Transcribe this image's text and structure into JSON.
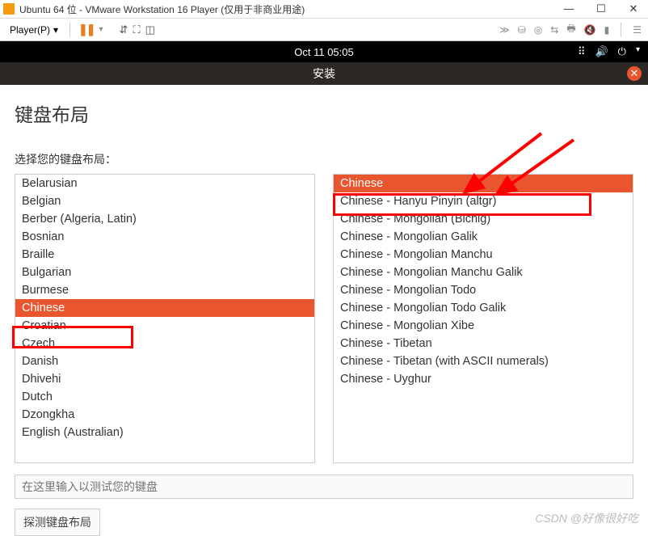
{
  "vmware": {
    "title": "Ubuntu 64 位 - VMware Workstation 16 Player (仅用于非商业用途)",
    "player_label": "Player(P)"
  },
  "ubuntu": {
    "clock": "Oct 11  05:05"
  },
  "installer": {
    "header": "安装",
    "title": "键盘布局",
    "prompt": "选择您的键盘布局：",
    "test_placeholder": "在这里输入以测试您的键盘",
    "detect_label": "探测键盘布局"
  },
  "left_list": [
    "Belarusian",
    "Belgian",
    "Berber (Algeria, Latin)",
    "Bosnian",
    "Braille",
    "Bulgarian",
    "Burmese",
    "Chinese",
    "Croatian",
    "Czech",
    "Danish",
    "Dhivehi",
    "Dutch",
    "Dzongkha",
    "English (Australian)"
  ],
  "left_selected_index": 7,
  "right_list": [
    "Chinese",
    "Chinese - Hanyu Pinyin (altgr)",
    "Chinese - Mongolian (Bichig)",
    "Chinese - Mongolian Galik",
    "Chinese - Mongolian Manchu",
    "Chinese - Mongolian Manchu Galik",
    "Chinese - Mongolian Todo",
    "Chinese - Mongolian Todo Galik",
    "Chinese - Mongolian Xibe",
    "Chinese - Tibetan",
    "Chinese - Tibetan (with ASCII numerals)",
    "Chinese - Uyghur"
  ],
  "right_selected_index": 0,
  "watermark": "CSDN @好像很好吃"
}
